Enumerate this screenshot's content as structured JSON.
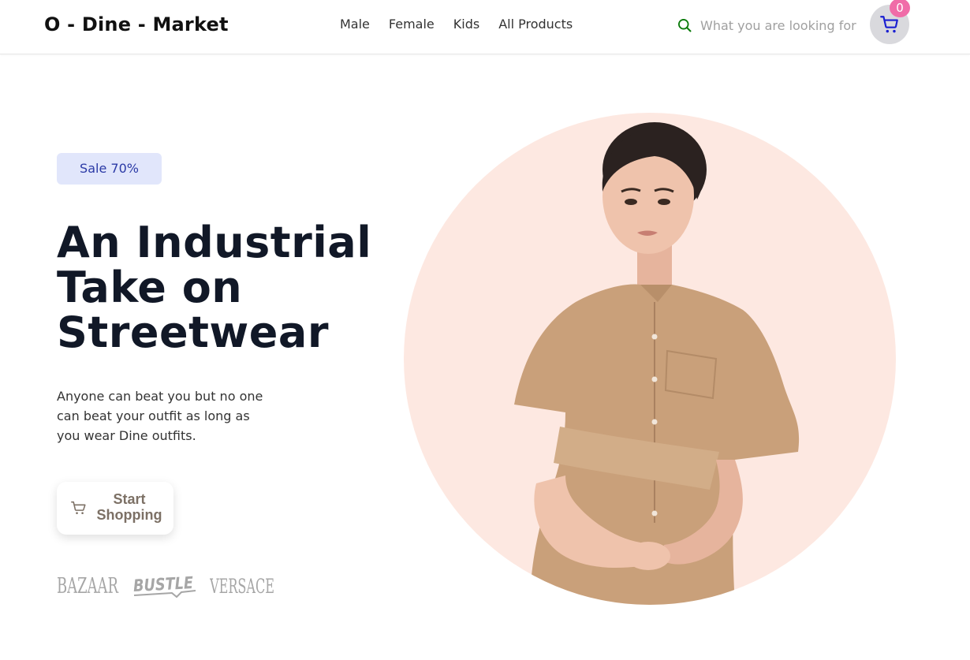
{
  "header": {
    "logo": "O - Dine - Market",
    "nav": [
      "Male",
      "Female",
      "Kids",
      "All Products"
    ],
    "search": {
      "placeholder": "What you are looking for",
      "value": ""
    },
    "cart": {
      "count": "0",
      "icon": "cart-icon"
    }
  },
  "hero": {
    "badge": "Sale 70%",
    "headline": [
      "An Industrial",
      "Take on",
      "Streetwear"
    ],
    "description": "Anyone can beat you but no one can beat your outfit as long as you wear Dine outfits.",
    "cta": {
      "label": "Start Shopping",
      "icon": "cart-icon"
    },
    "brands": [
      "BAZAAR",
      "BUSTLE",
      "VERSACE"
    ],
    "image": {
      "subject": "woman-in-tan-dress"
    }
  },
  "colors": {
    "accent_badge_bg": "#e1e6fb",
    "accent_badge_text": "#2b3aa6",
    "cart_badge": "#f06ca8",
    "hero_circle": "#fde8e1",
    "headline": "#111827",
    "cta_text": "#7c7065",
    "search_icon": "#0a7a0a",
    "cart_icon": "#1a1fd1"
  }
}
